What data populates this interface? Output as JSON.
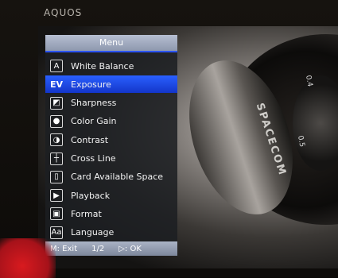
{
  "brand": "AQUOS",
  "menu": {
    "title": "Menu",
    "items": [
      {
        "label": "White Balance",
        "icon": "white-balance-icon",
        "glyph": "A"
      },
      {
        "label": "Exposure",
        "icon": "exposure-icon",
        "glyph": "EV",
        "selected": true
      },
      {
        "label": "Sharpness",
        "icon": "sharpness-icon",
        "glyph": "◩"
      },
      {
        "label": "Color Gain",
        "icon": "color-gain-icon",
        "glyph": "●"
      },
      {
        "label": "Contrast",
        "icon": "contrast-icon",
        "glyph": "◑"
      },
      {
        "label": "Cross Line",
        "icon": "cross-line-icon",
        "glyph": "┼"
      },
      {
        "label": "Card Available Space",
        "icon": "sd-card-icon",
        "glyph": "▯"
      },
      {
        "label": "Playback",
        "icon": "playback-icon",
        "glyph": "▶"
      },
      {
        "label": "Format",
        "icon": "format-icon",
        "glyph": "▣"
      },
      {
        "label": "Language",
        "icon": "language-icon",
        "glyph": "Aa"
      }
    ],
    "footer": {
      "exit": "M: Exit",
      "page": "1/2",
      "ok": "▷: OK"
    }
  },
  "lens": {
    "text": "SPACECOM",
    "ring_value_1": "0.4",
    "ring_value_2": "0.5"
  }
}
